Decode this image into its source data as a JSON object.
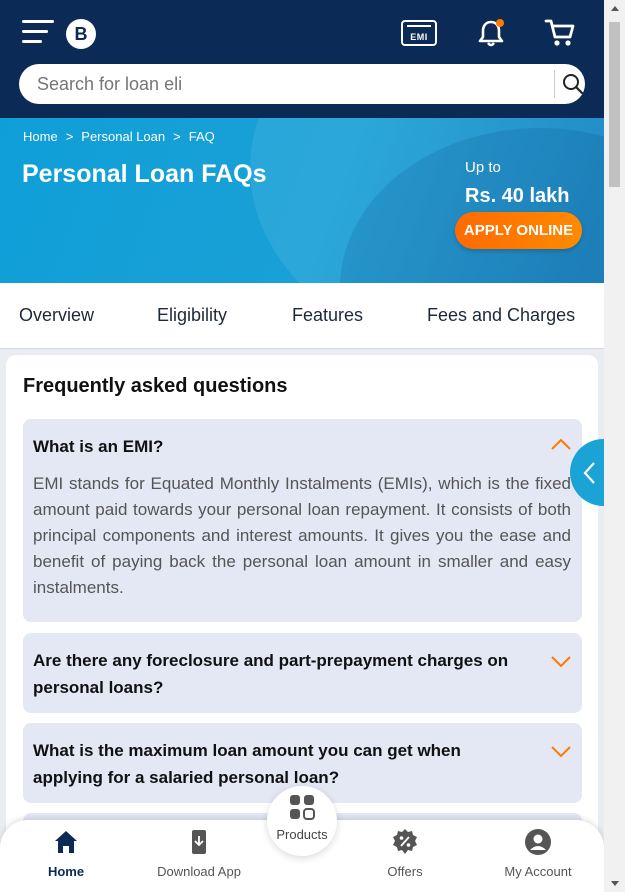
{
  "header": {
    "logo_text": "B",
    "emi_label": "EMI",
    "search_placeholder": "Search for loan eli"
  },
  "breadcrumb": [
    "Home",
    ">",
    "Personal Loan",
    ">",
    "FAQ"
  ],
  "hero": {
    "title": "Personal Loan FAQs",
    "upto": "Up to",
    "amount": "Rs. 40 lakh",
    "cta": "APPLY ONLINE"
  },
  "tabs": [
    "Overview",
    "Eligibility",
    "Features",
    "Fees and Charges"
  ],
  "faq_section": {
    "heading": "Frequently asked questions",
    "items": [
      {
        "question": "What is an EMI?",
        "answer": "EMI stands for Equated Monthly Instalments (EMIs), which is the fixed amount paid towards your personal loan repayment. It consists of both principal components and interest amounts. It gives you the ease and benefit of paying back the personal loan amount in smaller and easy instalments.",
        "expanded": true
      },
      {
        "question": "Are there any foreclosure and part-prepayment charges on personal loans?",
        "expanded": false
      },
      {
        "question": "What is the maximum loan amount you can get when applying for a salaried personal loan?",
        "expanded": false
      }
    ]
  },
  "bottom_nav": {
    "home": "Home",
    "download": "Download App",
    "products": "Products",
    "offers": "Offers",
    "account": "My Account"
  },
  "colors": {
    "header_bg": "#0b2a55",
    "hero_blue": "#1aa0d6",
    "accent_orange": "#ff7a00",
    "faq_bg": "#e3e8f4"
  }
}
